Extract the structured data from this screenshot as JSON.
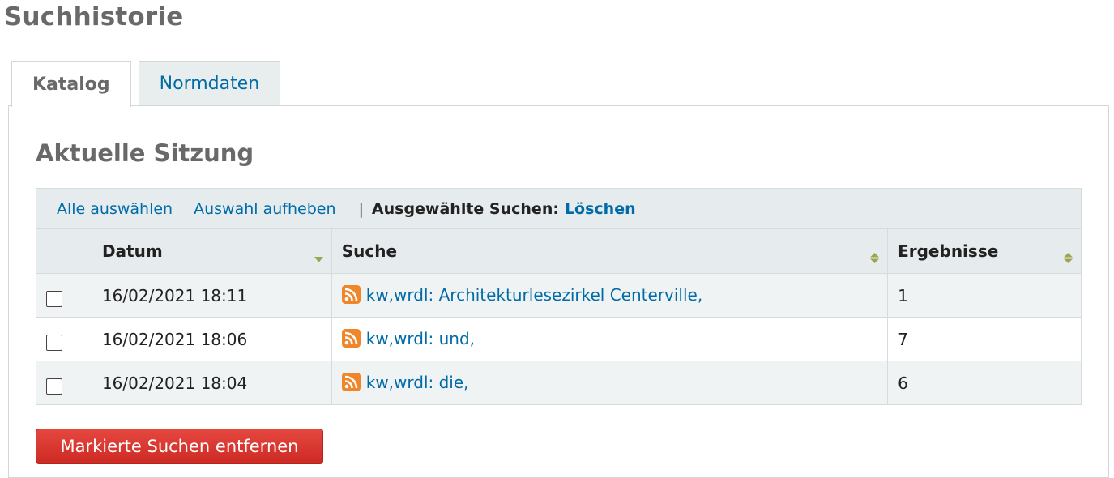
{
  "page": {
    "title": "Suchhistorie"
  },
  "tabs": [
    {
      "label": "Katalog",
      "active": true
    },
    {
      "label": "Normdaten",
      "active": false
    }
  ],
  "section": {
    "title": "Aktuelle Sitzung"
  },
  "toolbar": {
    "select_all": "Alle auswählen",
    "deselect": "Auswahl aufheben",
    "separator": "|",
    "selected_label": "Ausgewählte Suchen:",
    "delete": "Löschen"
  },
  "table": {
    "headers": {
      "date": "Datum",
      "search": "Suche",
      "results": "Ergebnisse"
    },
    "rows": [
      {
        "checked": false,
        "date": "16/02/2021 18:11",
        "query": "kw,wrdl: Architekturlesezirkel Centerville,",
        "results": "1"
      },
      {
        "checked": false,
        "date": "16/02/2021 18:06",
        "query": "kw,wrdl: und,",
        "results": "7"
      },
      {
        "checked": false,
        "date": "16/02/2021 18:04",
        "query": "kw,wrdl: die,",
        "results": "6"
      }
    ]
  },
  "actions": {
    "remove_selected": "Markierte Suchen entfernen"
  },
  "colors": {
    "link": "#006ba7",
    "heading": "#696969",
    "header_bg": "#e6eced",
    "row_alt_bg": "#f0f3f3",
    "sort_arrow": "#9ca54f",
    "rss_orange": "#f0862a",
    "danger_button": "#d9352e"
  },
  "icons": {
    "feed": "rss-feed-icon",
    "sort": "sort-icon"
  }
}
